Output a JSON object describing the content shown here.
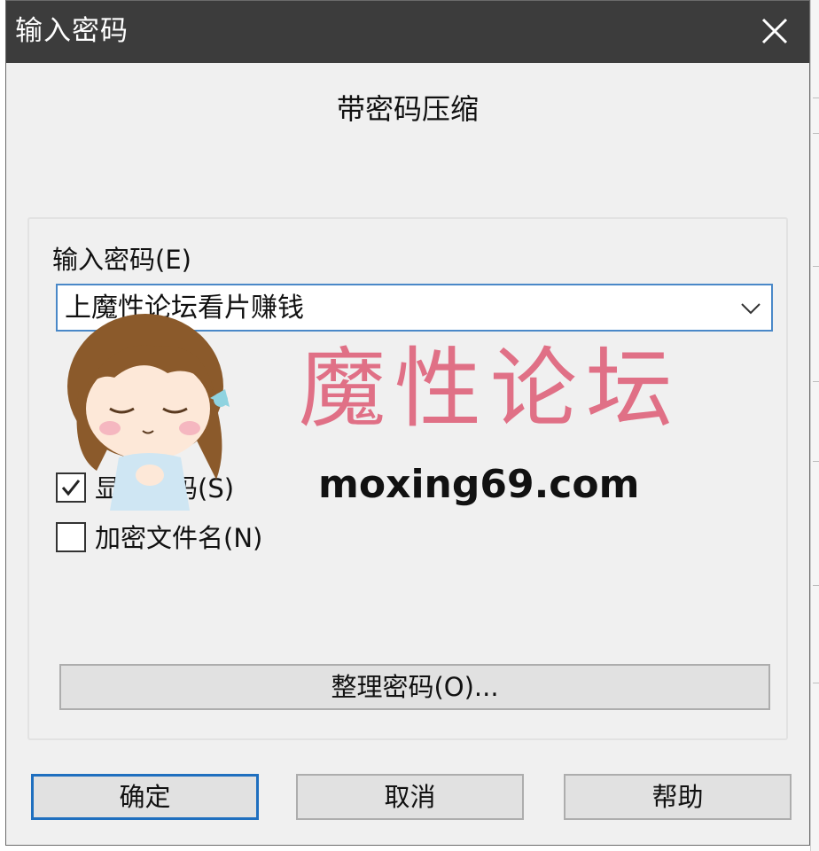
{
  "window": {
    "title": "输入密码",
    "close_icon": "close-icon"
  },
  "heading": "带密码压缩",
  "password": {
    "label": "输入密码(E)",
    "value": "上魔性论坛看片赚钱",
    "dropdown_icon": "chevron-down-icon"
  },
  "options": {
    "show_password": {
      "label": "显示密码(S)",
      "checked": true
    },
    "encrypt_filenames": {
      "label": "加密文件名(N)",
      "checked": false
    }
  },
  "organize_button": "整理密码(O)...",
  "buttons": {
    "ok": "确定",
    "cancel": "取消",
    "help": "帮助"
  },
  "watermark": {
    "text": "魔性论坛",
    "url": "moxing69.com",
    "color": "#e07086",
    "mascot_icon": "cartoon-girl-mascot"
  },
  "colors": {
    "titlebar": "#3c3c3c",
    "dialog_bg": "#f0f0f0",
    "focus_border": "#1f6fbf"
  }
}
